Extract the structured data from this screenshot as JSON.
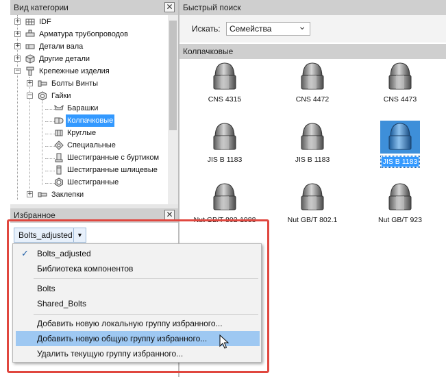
{
  "category_panel": {
    "title": "Вид категории",
    "close": "✕",
    "tree": [
      {
        "label": "IDF",
        "expander": "+",
        "icon": "grid-icon"
      },
      {
        "label": "Арматура трубопроводов",
        "expander": "+",
        "icon": "valve-icon"
      },
      {
        "label": "Детали вала",
        "expander": "+",
        "icon": "shaft-icon"
      },
      {
        "label": "Другие детали",
        "expander": "+",
        "icon": "cube-icon"
      },
      {
        "label": "Крепежные изделия",
        "expander": "−",
        "icon": "fastener-icon"
      },
      {
        "label": "Болты  Винты",
        "expander": "+",
        "icon": "bolt-icon"
      },
      {
        "label": "Гайки",
        "expander": "−",
        "icon": "nut-icon"
      },
      {
        "label": "Барашки",
        "expander": "",
        "icon": "wing-nut-icon"
      },
      {
        "label": "Колпачковые",
        "expander": "",
        "icon": "cap-nut-icon",
        "selected": true
      },
      {
        "label": "Круглые",
        "expander": "",
        "icon": "round-nut-icon"
      },
      {
        "label": "Специальные",
        "expander": "",
        "icon": "special-nut-icon"
      },
      {
        "label": "Шестигранные с буртиком",
        "expander": "",
        "icon": "flange-nut-icon"
      },
      {
        "label": "Шестигранные шлицевые",
        "expander": "",
        "icon": "slotted-nut-icon"
      },
      {
        "label": "Шестигранные",
        "expander": "",
        "icon": "hex-nut-icon"
      },
      {
        "label": "Заклепки",
        "expander": "+",
        "icon": "rivet-icon"
      }
    ]
  },
  "quick_search": {
    "title": "Быстрый поиск",
    "search_label": "Искать:",
    "search_value": "Семейства",
    "dropdown_arrow": "⌄"
  },
  "results": {
    "section_title": "Колпачковые",
    "items": [
      {
        "caption": "CNS 4315"
      },
      {
        "caption": "CNS 4472"
      },
      {
        "caption": "CNS 4473"
      },
      {
        "caption": "JIS B 1183"
      },
      {
        "caption": "JIS B 1183"
      },
      {
        "caption": "JIS B 1183",
        "selected": true
      },
      {
        "caption": "Nut GB/T 802-1988"
      },
      {
        "caption": "Nut GB/T 802.1"
      },
      {
        "caption": "Nut GB/T 923"
      }
    ]
  },
  "favorites_panel": {
    "title": "Избранное",
    "close": "✕",
    "selected_group": "Bolts_adjusted",
    "dropdown_arrow": "▼",
    "menu": {
      "checkmark": "✓",
      "items": [
        {
          "label": "Bolts_adjusted",
          "checked": true
        },
        {
          "label": "Библиотека компонентов"
        },
        {
          "label": "Bolts"
        },
        {
          "label": "Shared_Bolts"
        },
        {
          "label": "Добавить новую локальную группу избранного..."
        },
        {
          "label": "Добавить новую общую группу избранного...",
          "highlighted": true
        },
        {
          "label": "Удалить текущую группу избранного..."
        }
      ]
    }
  },
  "colors": {
    "selection": "#3399ff",
    "menu_highlight": "#9ec8f2",
    "annotation_frame": "#e0473f",
    "header": "#cfcfcf"
  }
}
